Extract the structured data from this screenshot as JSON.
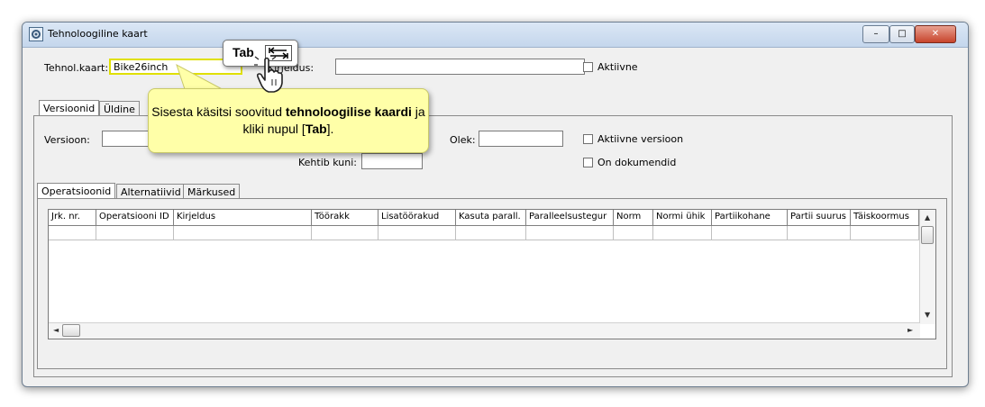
{
  "window": {
    "title": "Tehnoloogiline kaart",
    "controls": {
      "minimize": "–",
      "maximize": "□",
      "close": "✕"
    }
  },
  "header": {
    "tehnol_label": "Tehnol.kaart:",
    "tehnol_value": "Bike26inch",
    "kirjeldus_label": "Kirjeldus:",
    "kirjeldus_value": "",
    "aktiivne_label": "Aktiivne"
  },
  "tabs": [
    "Versioonid",
    "Üldine"
  ],
  "version_panel": {
    "versioon_label": "Versioon:",
    "versioon_value": "",
    "olek_label": "Olek:",
    "olek_value": "",
    "kehtib_label": "Kehtib kuni:",
    "kehtib_value": "",
    "aktiivne_versioon_label": "Aktiivne versioon",
    "on_dokumendid_label": "On dokumendid"
  },
  "subtabs": [
    "Operatsioonid",
    "Alternatiivid",
    "Märkused"
  ],
  "grid": {
    "columns": [
      "Jrk. nr.",
      "Operatsiooni ID",
      "Kirjeldus",
      "Töörakk",
      "Lisatöörakud",
      "Kasuta parall.",
      "Paralleelsustegur",
      "Norm",
      "Normi ühik",
      "Partiikohane",
      "Partii suurus",
      "Täiskoormus"
    ]
  },
  "callout": {
    "text_part1": "Sisesta käsitsi soovitud ",
    "text_bold1": "tehnoloogilise kaardi",
    "text_part2": " ja kliki nupul [",
    "text_bold2": "Tab",
    "text_part3": "]."
  },
  "tab_key": {
    "label": "Tab"
  },
  "icons": {
    "app": "gear-app-icon",
    "hand": "hand-pointer-icon",
    "tab_arrow": "tab-arrow-icon"
  },
  "colors": {
    "highlight": "#ffff00",
    "callout_bg": "#ffffa8"
  }
}
